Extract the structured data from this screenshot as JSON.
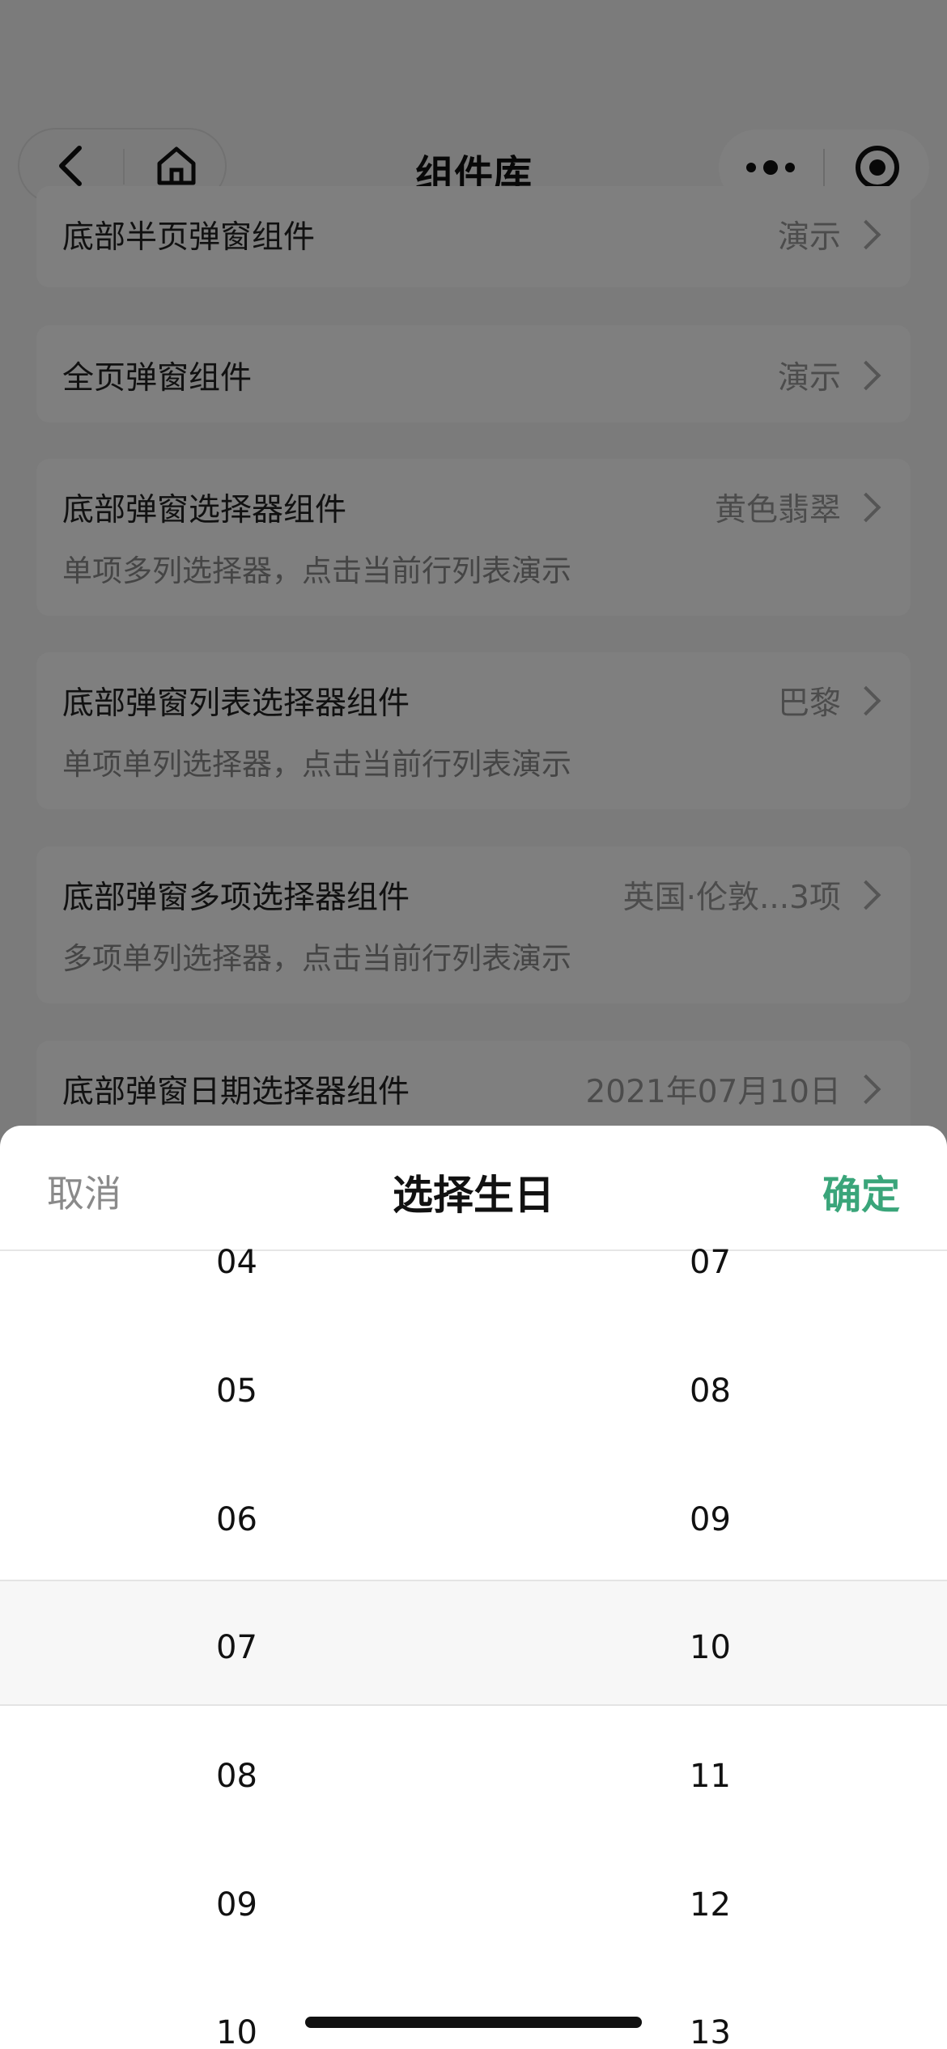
{
  "navbar": {
    "title": "组件库",
    "back_icon": "back-arrow-icon",
    "home_icon": "home-icon",
    "more_icon": "more-dots-icon",
    "close_icon": "target-close-icon"
  },
  "list": [
    {
      "title": "底部半页弹窗组件",
      "value": "演示",
      "subtitle": ""
    },
    {
      "title": "全页弹窗组件",
      "value": "演示",
      "subtitle": ""
    },
    {
      "title": "底部弹窗选择器组件",
      "value": "黄色翡翠",
      "subtitle": "单项多列选择器，点击当前行列表演示"
    },
    {
      "title": "底部弹窗列表选择器组件",
      "value": "巴黎",
      "subtitle": "单项单列选择器，点击当前行列表演示"
    },
    {
      "title": "底部弹窗多项选择器组件",
      "value": "英国·伦敦...3项",
      "subtitle": "多项单列选择器，点击当前行列表演示"
    },
    {
      "title": "底部弹窗日期选择器组件",
      "value": "2021年07月10日",
      "subtitle": ""
    }
  ],
  "sheet": {
    "cancel": "取消",
    "title": "选择生日",
    "confirm": "确定",
    "accent_color": "#3aa57a",
    "left_column": [
      "04",
      "05",
      "06",
      "07",
      "08",
      "09",
      "10"
    ],
    "right_column": [
      "07",
      "08",
      "09",
      "10",
      "11",
      "12",
      "13"
    ],
    "selected": {
      "left": "07",
      "right": "10"
    }
  }
}
